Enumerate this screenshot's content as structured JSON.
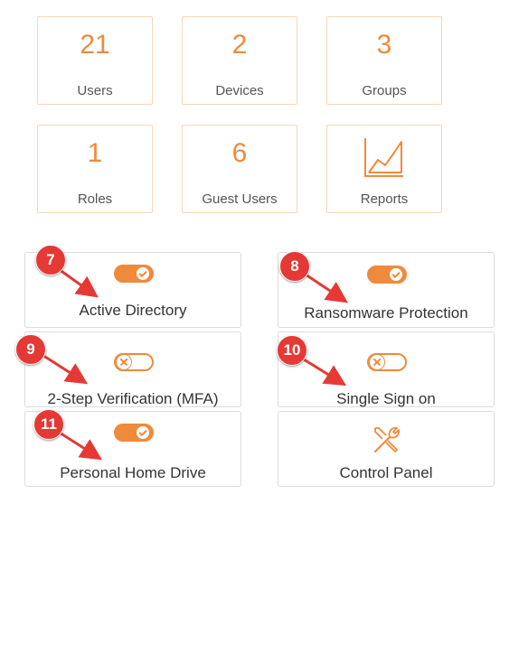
{
  "stats": [
    {
      "id": "users",
      "value": "21",
      "label": "Users"
    },
    {
      "id": "devices",
      "value": "2",
      "label": "Devices"
    },
    {
      "id": "groups",
      "value": "3",
      "label": "Groups"
    },
    {
      "id": "roles",
      "value": "1",
      "label": "Roles"
    },
    {
      "id": "guest-users",
      "value": "6",
      "label": "Guest Users"
    },
    {
      "id": "reports",
      "icon": "chart-icon",
      "label": "Reports"
    }
  ],
  "features": [
    {
      "id": "active-directory",
      "label": "Active Directory",
      "toggle": "on",
      "badge": "7"
    },
    {
      "id": "ransomware-protection",
      "label": "Ransomware Protection",
      "toggle": "on",
      "badge": "8"
    },
    {
      "id": "mfa",
      "label": "2-Step Verification (MFA)",
      "toggle": "off",
      "badge": "9"
    },
    {
      "id": "sso",
      "label": "Single Sign on",
      "toggle": "off",
      "badge": "10"
    },
    {
      "id": "home-drive",
      "label": "Personal Home Drive",
      "toggle": "on",
      "badge": "11"
    },
    {
      "id": "control-panel",
      "label": "Control Panel",
      "icon": "tools-icon"
    }
  ],
  "colors": {
    "accent": "#ef8a3c",
    "badge": "#e53935",
    "arrow": "#e53935"
  }
}
